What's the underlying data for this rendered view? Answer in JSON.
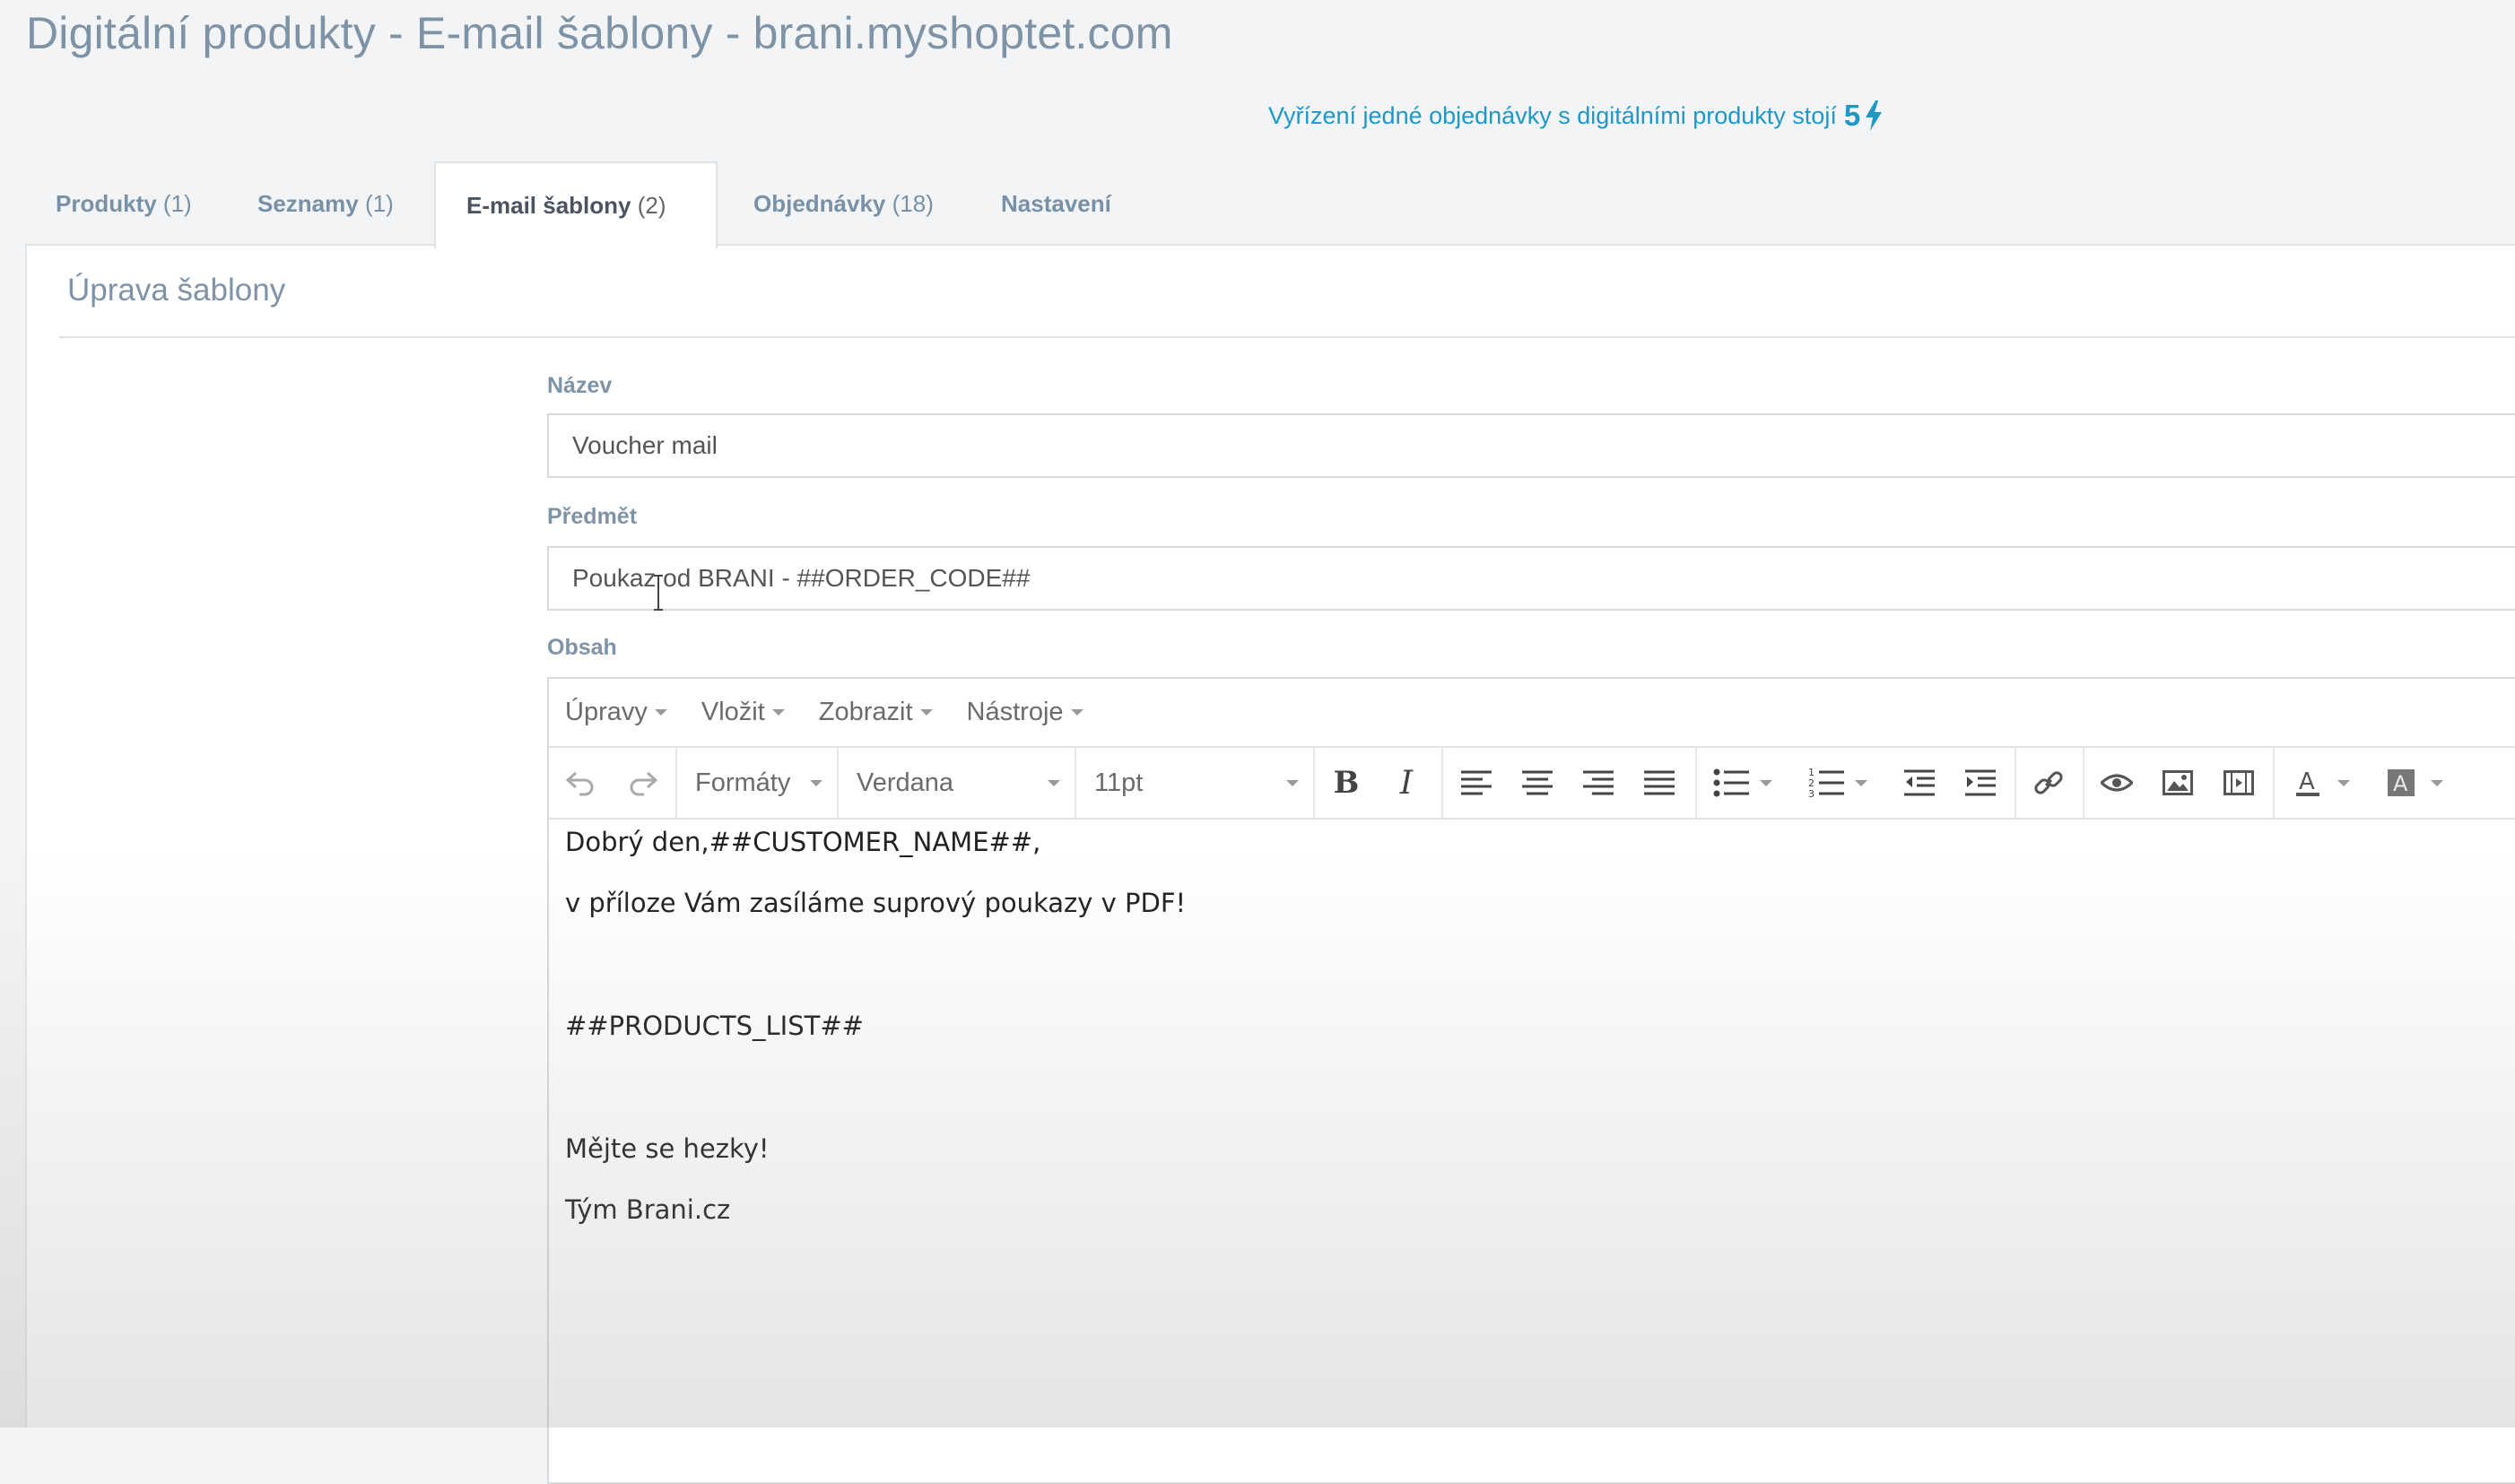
{
  "page": {
    "title": "Digitální produkty - E-mail šablony - brani.myshoptet.com",
    "cost_note": "Vyřízení jedné objednávky s digitálními produkty stojí",
    "cost_value": "5",
    "cost_icon": "lightning-bolt-icon"
  },
  "tabs": [
    {
      "label": "Produkty",
      "count": "(1)",
      "active": false
    },
    {
      "label": "Seznamy",
      "count": "(1)",
      "active": false
    },
    {
      "label": "E-mail šablony",
      "count": "(2)",
      "active": true
    },
    {
      "label": "Objednávky",
      "count": "(18)",
      "active": false
    },
    {
      "label": "Nastavení",
      "count": "",
      "active": false
    }
  ],
  "panel": {
    "title": "Úprava šablony"
  },
  "form": {
    "name_label": "Název",
    "name_value": "Voucher mail",
    "subject_label": "Předmět",
    "subject_value": "Poukaz od BRANI - ##ORDER_CODE##",
    "content_label": "Obsah"
  },
  "editor": {
    "menu": [
      "Úpravy",
      "Vložit",
      "Zobrazit",
      "Nástroje"
    ],
    "toolbar": {
      "formats": "Formáty",
      "font": "Verdana",
      "size": "11pt"
    },
    "content_lines": [
      "Dobrý den,##CUSTOMER_NAME##,",
      "v příloze Vám zasíláme suprový poukazy v PDF!",
      "",
      "##PRODUCTS_LIST##",
      "",
      "Mějte se hezky!",
      "Tým Brani.cz"
    ]
  },
  "colors": {
    "title": "#7e93a6",
    "accent": "#1f98c6",
    "label": "#7e93a6",
    "border": "#d6dadd"
  }
}
